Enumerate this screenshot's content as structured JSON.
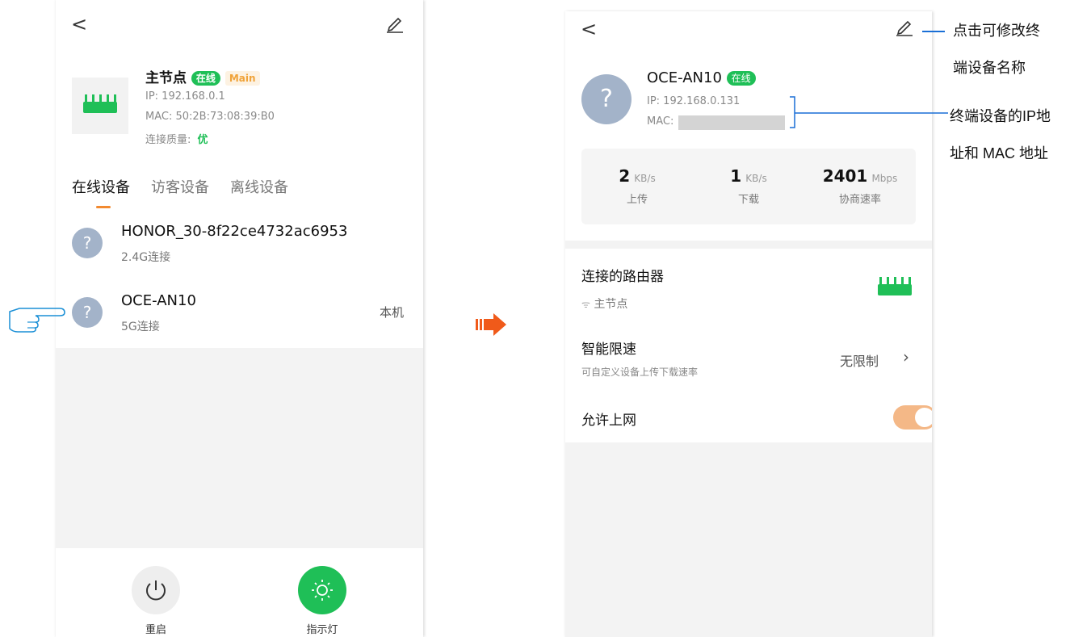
{
  "left_screen": {
    "header": {
      "back_glyph": "<",
      "edit_icon": "pencil-icon"
    },
    "node": {
      "name": "主节点",
      "status_badge": "在线",
      "role_badge": "Main",
      "ip": "IP:  192.168.0.1",
      "mac": "MAC:  50:2B:73:08:39:B0",
      "quality_label": "连接质量:",
      "quality_value": "优"
    },
    "tabs": [
      {
        "label": "在线设备",
        "active": true
      },
      {
        "label": "访客设备",
        "active": false
      },
      {
        "label": "离线设备",
        "active": false
      }
    ],
    "devices": [
      {
        "name": "HONOR_30-8f22ce4732ac6953",
        "conn": "2.4G连接",
        "tag": ""
      },
      {
        "name": "OCE-AN10",
        "conn": "5G连接",
        "tag": "本机"
      }
    ],
    "bottom_actions": [
      {
        "label": "重启",
        "icon": "power-icon"
      },
      {
        "label": "指示灯",
        "icon": "sun-icon"
      }
    ]
  },
  "right_screen": {
    "header": {
      "back_glyph": "<",
      "edit_icon": "pencil-icon"
    },
    "device": {
      "name": "OCE-AN10",
      "status_badge": "在线",
      "ip": "IP: 192.168.0.131",
      "mac_label": "MAC:"
    },
    "stats": [
      {
        "value": "2",
        "unit": "KB/s",
        "label": "上传"
      },
      {
        "value": "1",
        "unit": "KB/s",
        "label": "下载"
      },
      {
        "value": "2401",
        "unit": "Mbps",
        "label": "协商速率"
      }
    ],
    "router": {
      "title": "连接的路由器",
      "sub": "主节点",
      "wifi_icon": "wifi-icon"
    },
    "speed_limit": {
      "title": "智能限速",
      "sub": "可自定义设备上传下载速率",
      "value": "无限制"
    },
    "internet": {
      "title": "允许上网",
      "enabled": true
    }
  },
  "annotations": {
    "edit_name_line1": "点击可修改终",
    "edit_name_line2": "端设备名称",
    "ip_mac_line1": "终端设备的IP地",
    "ip_mac_line2": "址和 MAC 地址"
  },
  "colors": {
    "green": "#1fbf57",
    "orange": "#f28a30",
    "arrow": "#f05a1a",
    "annotation_line": "#1a6fd6",
    "avatar": "#a3b3c9"
  }
}
